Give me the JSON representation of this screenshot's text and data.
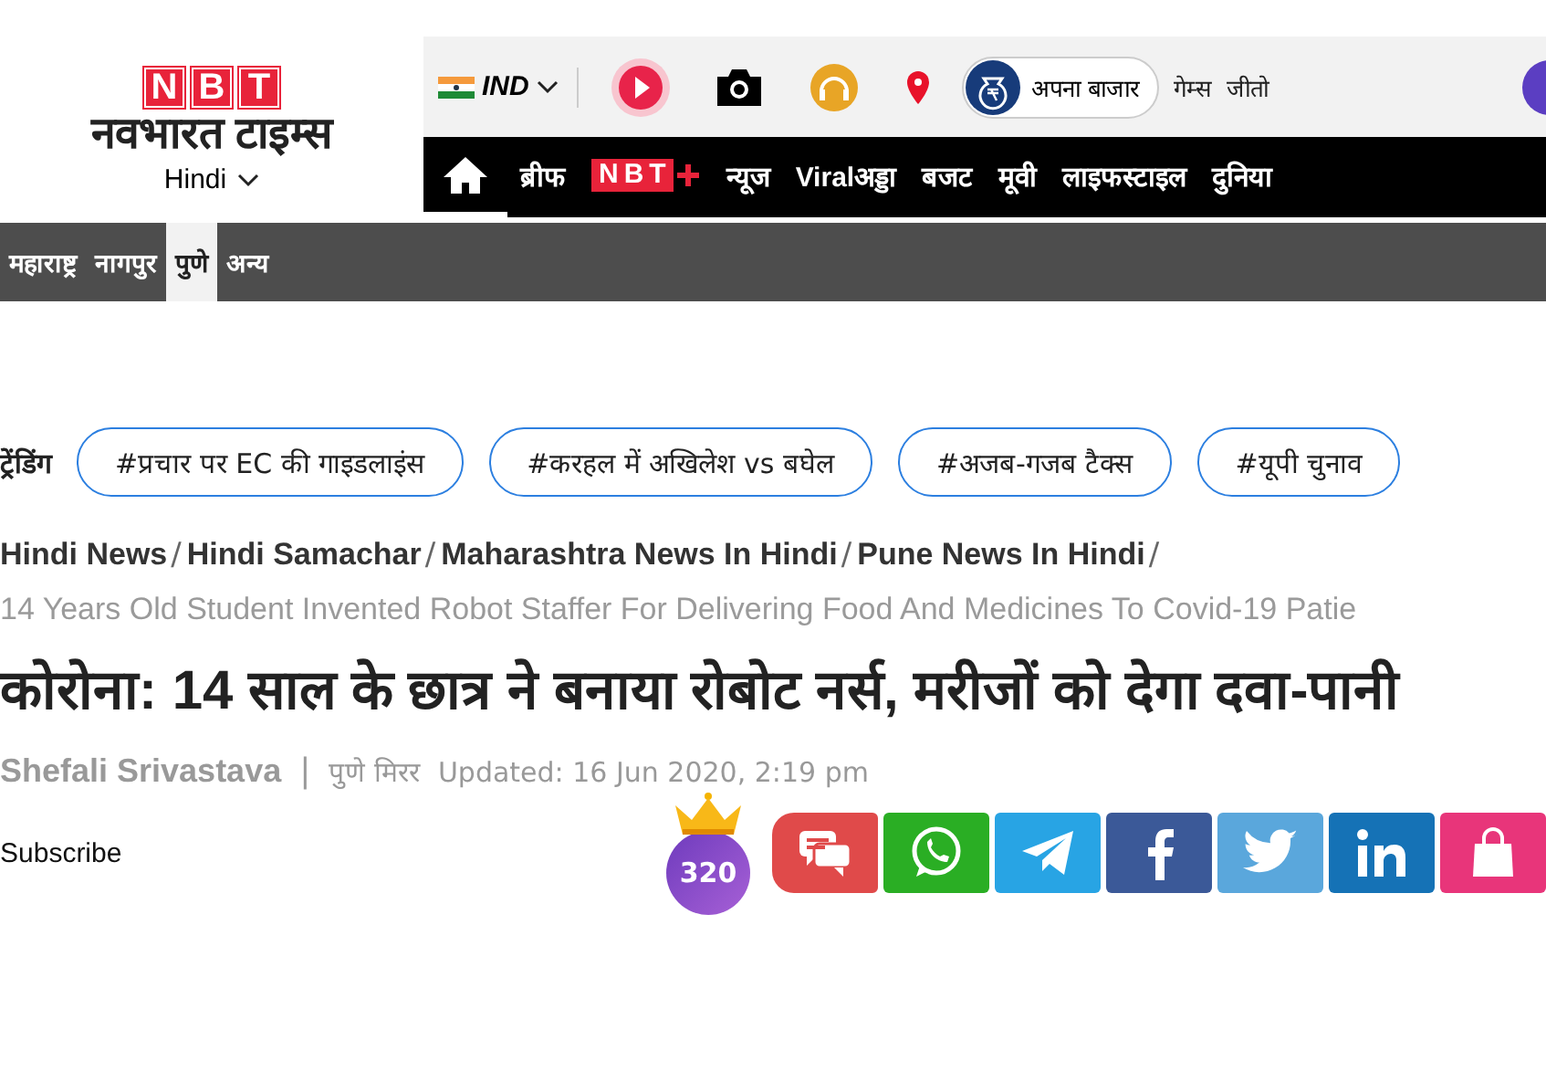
{
  "logo": {
    "letters": [
      "N",
      "B",
      "T"
    ],
    "name": "नवभारत टाइम्स",
    "language": "Hindi"
  },
  "topbar": {
    "edition": "IND",
    "market": "अपना बाजार",
    "links": [
      "गेम्स",
      "जीतो"
    ]
  },
  "nav": [
    {
      "kind": "home",
      "selected": true
    },
    {
      "kind": "text",
      "label": "ब्रीफ",
      "selected": false
    },
    {
      "kind": "nbtplus",
      "label": "NBT",
      "selected": false
    },
    {
      "kind": "text",
      "label": "न्यूज",
      "selected": false
    },
    {
      "kind": "text",
      "label": "Viralअड्डा",
      "selected": false
    },
    {
      "kind": "text",
      "label": "बजट",
      "selected": false
    },
    {
      "kind": "text",
      "label": "मूवी",
      "selected": false
    },
    {
      "kind": "text",
      "label": "लाइफस्टाइल",
      "selected": false
    },
    {
      "kind": "text",
      "label": "दुनिया",
      "selected": false
    }
  ],
  "subnav": [
    {
      "label": "महाराष्ट्र",
      "selected": false
    },
    {
      "label": "नागपुर",
      "selected": false
    },
    {
      "label": "पुणे",
      "selected": true
    },
    {
      "label": "अन्य",
      "selected": false
    }
  ],
  "trending": {
    "label": "ट्रेंडिंग",
    "tags": [
      "#प्रचार पर EC की गाइडलाइंस",
      "#करहल में अखिलेश vs बघेल",
      "#अजब-गजब टैक्स",
      "#यूपी चुनाव"
    ]
  },
  "breadcrumbs": [
    {
      "label": "Hindi News",
      "separator": "/"
    },
    {
      "label": "Hindi Samachar",
      "separator": "/"
    },
    {
      "label": "Maharashtra News In Hindi",
      "separator": "/"
    },
    {
      "label": "Pune News In Hindi",
      "separator": "/"
    }
  ],
  "breadcrumb_current": "14 Years Old Student Invented Robot Staffer For Delivering Food And Medicines To Covid-19 Patie",
  "headline": "कोरोना: 14 साल के छात्र ने बनाया रोबोट नर्स, मरीजों को देगा दवा-पानी",
  "byline": {
    "author": "Shefali Srivastava",
    "divider": "|",
    "source": "पुणे मिरर",
    "updated": "Updated: 16 Jun 2020, 2:19 pm"
  },
  "subscribe": "Subscribe",
  "points": "320",
  "share": [
    {
      "kind": "comments",
      "color": "#e04a4a"
    },
    {
      "kind": "whatsapp",
      "color": "#2aae24"
    },
    {
      "kind": "telegram",
      "color": "#28a4e4"
    },
    {
      "kind": "facebook",
      "color": "#3b5998"
    },
    {
      "kind": "twitter",
      "color": "#5aa7dc"
    },
    {
      "kind": "linkedin",
      "color": "#1572b6"
    },
    {
      "kind": "shop",
      "color": "#e8357a"
    }
  ]
}
